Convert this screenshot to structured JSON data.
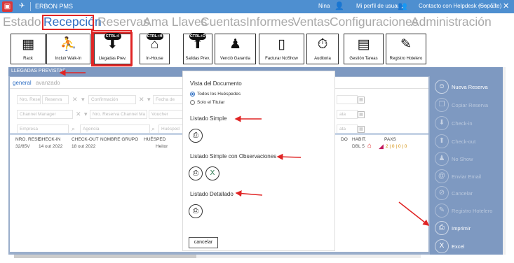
{
  "titlebar": {
    "app_icon": "app-logo-icon",
    "title": "ERBON PMS",
    "user": "Nina",
    "profile": "Mi perfil de usuario",
    "contact": "Contacto con Helpdesk (Soporte)",
    "minimize": "—",
    "maximize": "□",
    "close": "✕"
  },
  "menu": [
    {
      "label": "Estado",
      "active": false
    },
    {
      "label": "Recepción",
      "active": true
    },
    {
      "label": "Reservas",
      "active": false
    },
    {
      "label": "Ama Llaves",
      "active": false
    },
    {
      "label": "Cuentas",
      "active": false
    },
    {
      "label": "Informes",
      "active": false
    },
    {
      "label": "Ventas",
      "active": false
    },
    {
      "label": "Configuraciones",
      "active": false
    },
    {
      "label": "Administración",
      "active": false
    }
  ],
  "ribbon": [
    {
      "label": "Rack",
      "icon": "grid-icon",
      "badge": ""
    },
    {
      "label": "Incluir Walk-In",
      "icon": "walk-in-icon",
      "badge": ""
    },
    {
      "label": "Llegadas Prev.",
      "icon": "arrivals-icon",
      "badge": "CTRL+I"
    },
    {
      "label": "In-House",
      "icon": "house-icon",
      "badge": "CTRL+H"
    },
    {
      "label": "Salidas Prev.",
      "icon": "departures-icon",
      "badge": "CTRL+O"
    },
    {
      "label": "Venció Garantía",
      "icon": "guarantee-icon",
      "badge": ""
    },
    {
      "label": "Facturar NoShow",
      "icon": "document-icon",
      "badge": ""
    },
    {
      "label": "Auditoria",
      "icon": "audit-icon",
      "badge": ""
    },
    {
      "label": "Gestión Tareas",
      "icon": "tasks-icon",
      "badge": ""
    },
    {
      "label": "Registro Hotelero",
      "icon": "signature-icon",
      "badge": ""
    }
  ],
  "panel": {
    "title": "LLEGADAS PREVISTAS",
    "tabs": [
      "general",
      "avanzado"
    ],
    "filters_row1": [
      "Nro. Reserv",
      "Reserva",
      "Confirmación",
      "Fecha de"
    ],
    "filters_row2": [
      "Channel Manager",
      "Nro. Reserva Channel Ma",
      "Voucher"
    ],
    "filters_row3": [
      "Empresa",
      "Agencia",
      "Huésped"
    ],
    "right_filters": [
      "",
      "ata",
      "ata"
    ],
    "columns": [
      "NRO. RESEI",
      "CHECK-IN",
      "CHECK-OUT",
      "NOMBRE GRUPO",
      "HUÉSPED",
      "DO",
      "HABIT.",
      "PAXS"
    ],
    "rows": [
      {
        "nro": "32/85V",
        "checkin": "14 out 2022",
        "checkout": "18 out 2022",
        "grupo": "",
        "huesped": "Heitor",
        "do": "",
        "habit": "DBL 5",
        "paxs": "2 | 0 | 0 | 0"
      }
    ]
  },
  "actions": [
    {
      "label": "Nueva Reserva",
      "icon": "person-icon",
      "enabled": true
    },
    {
      "label": "Copiar Reserva",
      "icon": "copy-icon",
      "enabled": false
    },
    {
      "label": "Check-in",
      "icon": "checkin-icon",
      "enabled": false
    },
    {
      "label": "Check-out",
      "icon": "checkout-icon",
      "enabled": false
    },
    {
      "label": "No Show",
      "icon": "noshow-icon",
      "enabled": false
    },
    {
      "label": "Enviar Email",
      "icon": "email-icon",
      "enabled": false
    },
    {
      "label": "Cancelar",
      "icon": "cancel-icon",
      "enabled": false
    },
    {
      "label": "Registro Hotelero",
      "icon": "signature-icon",
      "enabled": false
    },
    {
      "label": "Imprimir",
      "icon": "printer-icon",
      "enabled": true
    },
    {
      "label": "Excel",
      "icon": "excel-icon",
      "enabled": true
    }
  ],
  "modal": {
    "title": "Vista del Documento",
    "radios": [
      {
        "label": "Todos los Huéspedes",
        "checked": true
      },
      {
        "label": "Solo el Titular",
        "checked": false
      }
    ],
    "sections": [
      {
        "label": "Listado Simple",
        "buttons": [
          "printer-icon"
        ]
      },
      {
        "label": "Listado Simple con Observaciones",
        "buttons": [
          "printer-icon",
          "excel-icon"
        ]
      },
      {
        "label": "Listado Detallado",
        "buttons": [
          "printer-icon"
        ]
      }
    ],
    "cancel": "cancelar"
  },
  "colors": {
    "titlebar": "#4e8fd0",
    "accent": "#2f6fc3",
    "panel": "#9aaecb",
    "actions": "#7e99c1",
    "annotation": "#e02424"
  }
}
